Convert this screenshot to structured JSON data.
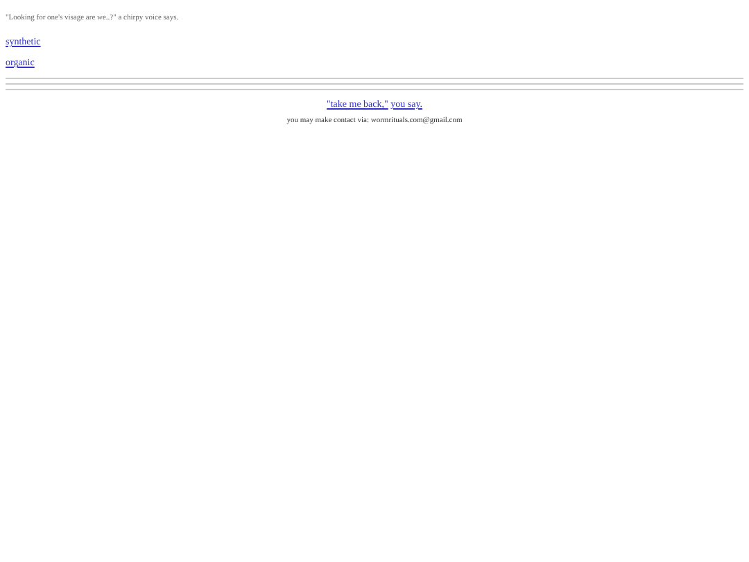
{
  "intro": "\"Looking for one's visage are we..?\" a chirpy voice says.",
  "links": [
    "synthetic",
    "organic"
  ],
  "back_links": [
    "\"take me back,\"",
    "you say."
  ],
  "contact": "you may make contact via: wormrituals.com@gmail.com"
}
